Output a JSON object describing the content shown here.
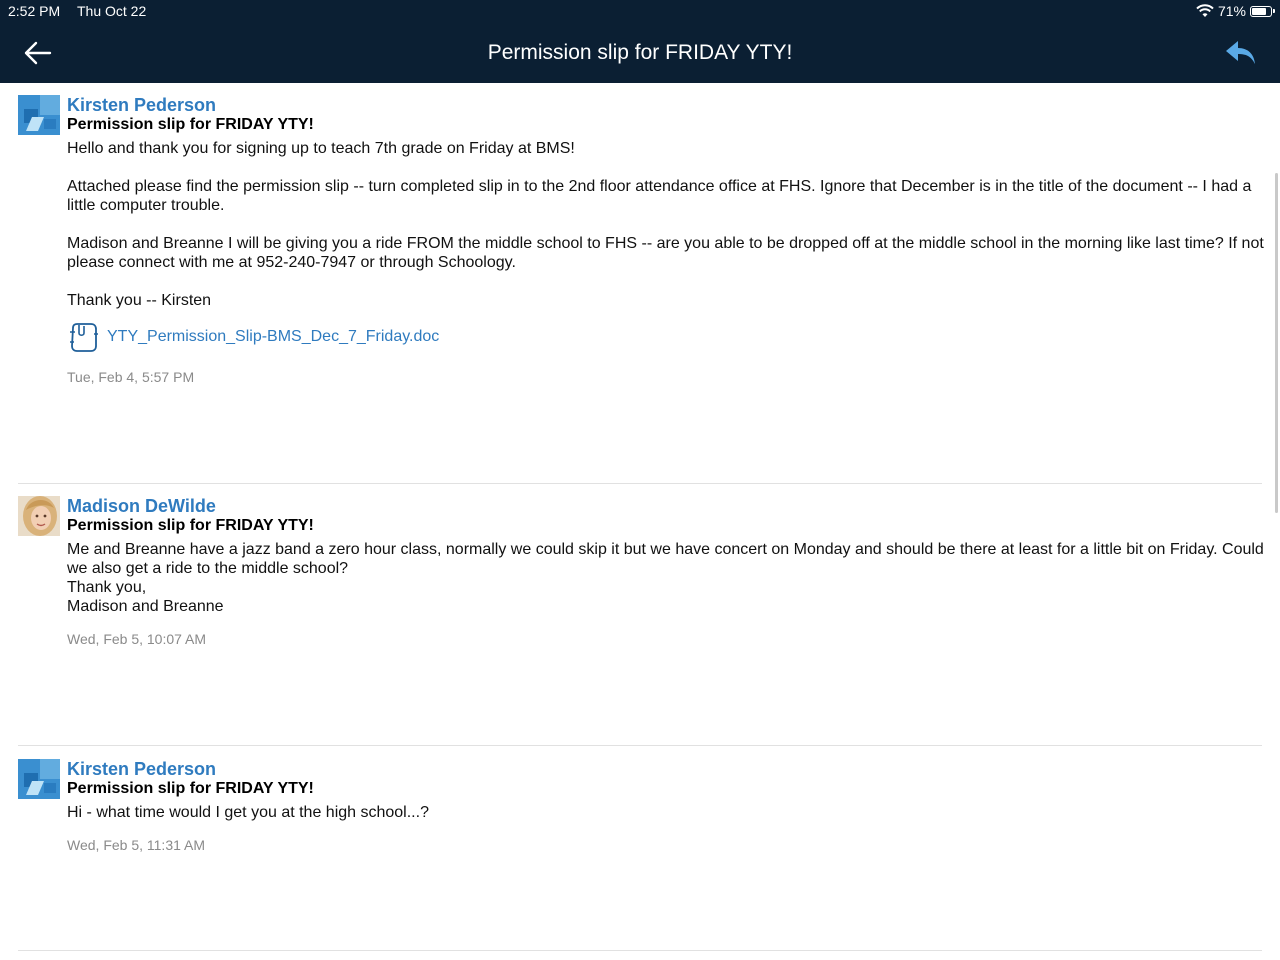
{
  "status_bar": {
    "time": "2:52 PM",
    "date": "Thu Oct 22",
    "battery": "71%",
    "battery_level": 0.71,
    "icons": [
      "wifi-icon",
      "battery-icon"
    ]
  },
  "header": {
    "title": "Permission slip for FRIDAY YTY!",
    "back_icon": "back-arrow-icon",
    "reply_icon": "reply-icon"
  },
  "messages": [
    {
      "author": "Kirsten Pederson",
      "subject": "Permission slip for FRIDAY YTY!",
      "paragraphs": [
        "Hello and thank you for signing up to teach 7th grade on Friday at BMS!",
        "Attached please find the permission slip -- turn completed slip in to the 2nd floor attendance office at FHS.  Ignore that December is in the title of the document -- I had a little computer trouble.",
        "Madison and Breanne I will be giving you a ride FROM the middle school to FHS -- are you able to be dropped off at the middle school in the morning like last time?  If not please connect with me at 952-240-7947 or through Schoology.",
        "Thank you -- Kirsten"
      ],
      "attachment": "YTY_Permission_Slip-BMS_Dec_7_Friday.doc",
      "timestamp": "Tue, Feb 4, 5:57 PM"
    },
    {
      "author": "Madison DeWilde",
      "subject": "Permission slip for FRIDAY YTY!",
      "lines": [
        "Me and Breanne have a jazz band a zero hour class, normally we could skip it but we have concert on Monday and should be there at least for a little bit on Friday. Could we also get a ride to the middle school?",
        "Thank you,",
        "Madison and Breanne"
      ],
      "timestamp": "Wed, Feb 5, 10:07 AM"
    },
    {
      "author": "Kirsten Pederson",
      "subject": "Permission slip for FRIDAY YTY!",
      "lines": [
        "Hi - what time would I get you at the high school...?"
      ],
      "timestamp": "Wed, Feb 5, 11:31 AM"
    }
  ],
  "colors": {
    "header_bg": "#0b1f33",
    "link": "#2f7bbf",
    "reply_icon": "#5aa9e6",
    "timestamp": "#8a8a8a"
  }
}
